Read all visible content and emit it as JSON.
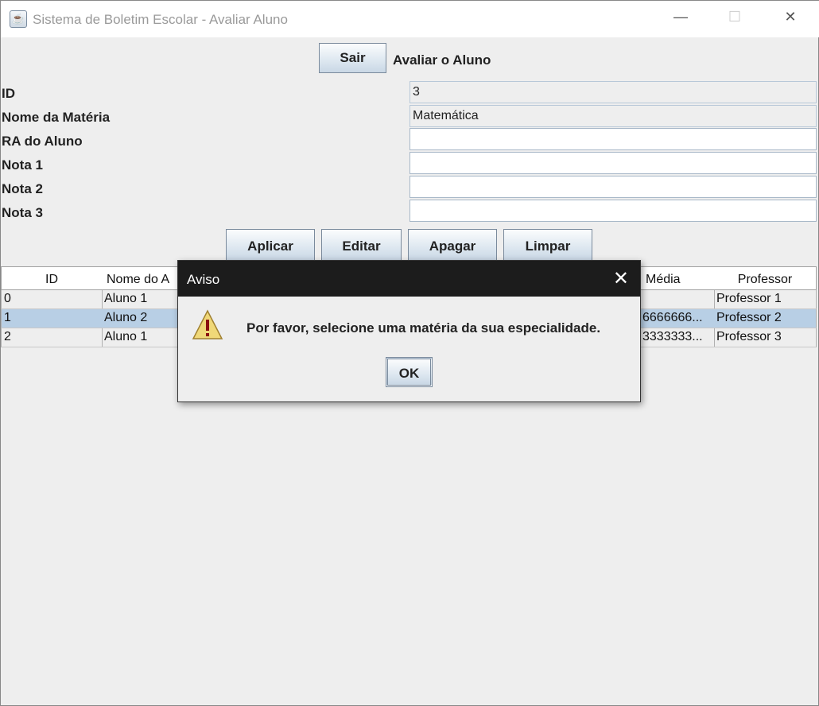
{
  "window": {
    "title": "Sistema de Boletim Escolar - Avaliar Aluno",
    "minimize": "—",
    "maximize": "☐",
    "close": "✕"
  },
  "header": {
    "exit_button": "Sair",
    "heading": "Avaliar o Aluno"
  },
  "form": {
    "id": {
      "label": "ID",
      "value": "3"
    },
    "subject": {
      "label": "Nome da Matéria",
      "value": "Matemática"
    },
    "ra": {
      "label": "RA do Aluno",
      "value": ""
    },
    "grade1": {
      "label": "Nota 1",
      "value": ""
    },
    "grade2": {
      "label": "Nota 2",
      "value": ""
    },
    "grade3": {
      "label": "Nota 3",
      "value": ""
    }
  },
  "actions": {
    "apply": "Aplicar",
    "edit": "Editar",
    "delete": "Apagar",
    "clear": "Limpar"
  },
  "table": {
    "headers": {
      "id": "ID",
      "name": "Nome do A",
      "average": "Média",
      "teacher": "Professor"
    },
    "rows": [
      {
        "id": "0",
        "name": "Aluno 1",
        "average": "",
        "teacher": "Professor 1"
      },
      {
        "id": "1",
        "name": "Aluno 2",
        "average": "6666666...",
        "teacher": "Professor 2"
      },
      {
        "id": "2",
        "name": "Aluno 1",
        "average": "3333333...",
        "teacher": "Professor 3"
      }
    ],
    "selected_row": 1,
    "selection_color": "#b8cfe5"
  },
  "dialog": {
    "title": "Aviso",
    "close": "✕",
    "icon": "warning-icon",
    "message": "Por favor, selecione uma matéria da sua especialidade.",
    "ok": "OK"
  }
}
